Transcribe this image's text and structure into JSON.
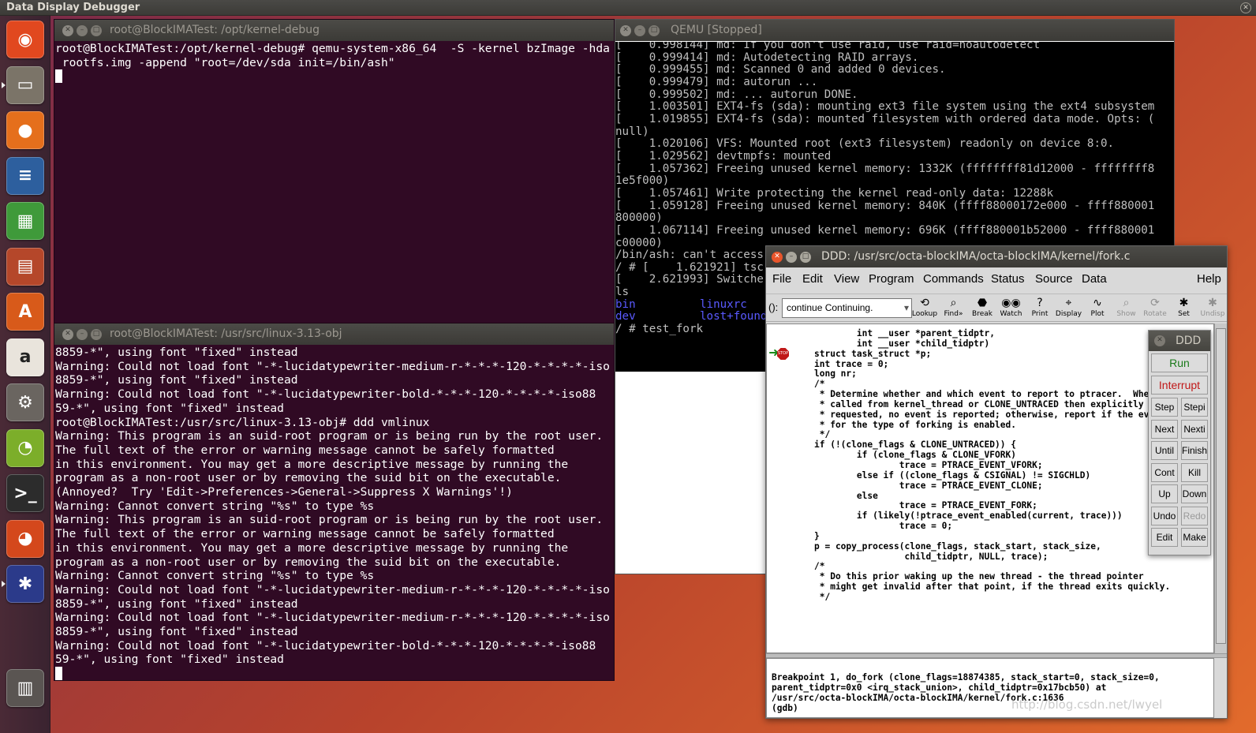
{
  "topbar": {
    "title": "Data Display Debugger"
  },
  "launcher": {
    "items": [
      {
        "name": "ubuntu-dash-icon",
        "glyph": "◉",
        "bg": "#e1481f"
      },
      {
        "name": "files-icon",
        "glyph": "▭",
        "bg": "#7b7468"
      },
      {
        "name": "firefox-icon",
        "glyph": "●",
        "bg": "#e56f1c"
      },
      {
        "name": "writer-icon",
        "glyph": "≡",
        "bg": "#2d5f9e"
      },
      {
        "name": "calc-icon",
        "glyph": "▦",
        "bg": "#3f9a3a"
      },
      {
        "name": "impress-icon",
        "glyph": "▤",
        "bg": "#b5472a"
      },
      {
        "name": "software-center-icon",
        "glyph": "A",
        "bg": "#d85a1a"
      },
      {
        "name": "amazon-icon",
        "glyph": "a",
        "bg": "#e9e4dc"
      },
      {
        "name": "system-settings-icon",
        "glyph": "⚙",
        "bg": "#6a6560"
      },
      {
        "name": "ide-icon",
        "glyph": "◔",
        "bg": "#7cae2a"
      },
      {
        "name": "terminal-icon",
        "glyph": ">_",
        "bg": "#2c2c2c"
      },
      {
        "name": "parrot-icon",
        "glyph": "◕",
        "bg": "#d4481c"
      },
      {
        "name": "ddd-bug-icon",
        "glyph": "✱",
        "bg": "#2b3a8a"
      },
      {
        "name": "trash-icon",
        "glyph": "▥",
        "bg": "#5a5552"
      }
    ]
  },
  "term1": {
    "title": "root@BlockIMATest: /opt/kernel-debug",
    "lines": [
      "root@BlockIMATest:/opt/kernel-debug# qemu-system-x86_64  -S -kernel bzImage -hda",
      " rootfs.img -append \"root=/dev/sda init=/bin/ash\""
    ]
  },
  "term2": {
    "title": "root@BlockIMATest: /usr/src/linux-3.13-obj",
    "lines": [
      "8859-*\", using font \"fixed\" instead",
      "Warning: Could not load font \"-*-lucidatypewriter-medium-r-*-*-*-120-*-*-*-*-iso",
      "8859-*\", using font \"fixed\" instead",
      "Warning: Could not load font \"-*-lucidatypewriter-bold-*-*-*-120-*-*-*-*-iso88",
      "59-*\", using font \"fixed\" instead",
      "root@BlockIMATest:/usr/src/linux-3.13-obj# ddd vmlinux",
      "Warning: This program is an suid-root program or is being run by the root user.",
      "The full text of the error or warning message cannot be safely formatted",
      "in this environment. You may get a more descriptive message by running the",
      "program as a non-root user or by removing the suid bit on the executable.",
      "(Annoyed?  Try 'Edit->Preferences->General->Suppress X Warnings'!)",
      "Warning: Cannot convert string \"%s\" to type %s",
      "Warning: This program is an suid-root program or is being run by the root user.",
      "The full text of the error or warning message cannot be safely formatted",
      "in this environment. You may get a more descriptive message by running the",
      "program as a non-root user or by removing the suid bit on the executable.",
      "Warning: Cannot convert string \"%s\" to type %s",
      "Warning: Could not load font \"-*-lucidatypewriter-medium-r-*-*-*-120-*-*-*-*-iso",
      "8859-*\", using font \"fixed\" instead",
      "Warning: Could not load font \"-*-lucidatypewriter-medium-r-*-*-*-120-*-*-*-*-iso",
      "8859-*\", using font \"fixed\" instead",
      "Warning: Could not load font \"-*-lucidatypewriter-bold-*-*-*-120-*-*-*-*-iso88",
      "59-*\", using font \"fixed\" instead"
    ]
  },
  "qemu": {
    "title": "QEMU [Stopped]",
    "lines": [
      "[    0.998144] md: If you don't use raid, use raid=noautodetect",
      "[    0.999414] md: Autodetecting RAID arrays.",
      "[    0.999455] md: Scanned 0 and added 0 devices.",
      "[    0.999479] md: autorun ...",
      "[    0.999502] md: ... autorun DONE.",
      "[    1.003501] EXT4-fs (sda): mounting ext3 file system using the ext4 subsystem",
      "[    1.019855] EXT4-fs (sda): mounted filesystem with ordered data mode. Opts: (",
      "null)",
      "[    1.020106] VFS: Mounted root (ext3 filesystem) readonly on device 8:0.",
      "[    1.029562] devtmpfs: mounted",
      "[    1.057362] Freeing unused kernel memory: 1332K (ffffffff81d12000 - ffffffff8",
      "1e5f000)",
      "[    1.057461] Write protecting the kernel read-only data: 12288k",
      "[    1.059128] Freeing unused kernel memory: 840K (ffff88000172e000 - ffff880001",
      "800000)",
      "[    1.067114] Freeing unused kernel memory: 696K (ffff880001b52000 - ffff880001",
      "c00000)",
      "/bin/ash: can't access",
      "/ # [    1.621921] tsc",
      "[    2.621993] Switche",
      "ls"
    ],
    "ls_col1": [
      "bin",
      "dev"
    ],
    "ls_col2": [
      "linuxrc",
      "lost+found"
    ],
    "prompt": "/ # test_fork"
  },
  "ddd": {
    "title": "DDD: /usr/src/octa-blockIMA/octa-blockIMA/kernel/fork.c",
    "menus": [
      "File",
      "Edit",
      "View",
      "Program",
      "Commands",
      "Status",
      "Source",
      "Data"
    ],
    "help": "Help",
    "arg_label": "():",
    "arg_value": "continue Continuing.",
    "tools": [
      {
        "label": "Lookup",
        "icon": "⟲",
        "disabled": false
      },
      {
        "label": "Find»",
        "icon": "⌕",
        "disabled": false
      },
      {
        "label": "Break",
        "icon": "⬣",
        "disabled": false
      },
      {
        "label": "Watch",
        "icon": "◉◉",
        "disabled": false
      },
      {
        "label": "Print",
        "icon": "?",
        "disabled": false
      },
      {
        "label": "Display",
        "icon": "⌖",
        "disabled": false
      },
      {
        "label": "Plot",
        "icon": "∿",
        "disabled": false
      },
      {
        "label": "Show",
        "icon": "⌕",
        "disabled": true
      },
      {
        "label": "Rotate",
        "icon": "⟳",
        "disabled": true
      },
      {
        "label": "Set",
        "icon": "✱",
        "disabled": false
      },
      {
        "label": "Undisp",
        "icon": "✱",
        "disabled": true
      }
    ],
    "stop_label": "STOP",
    "source": [
      "        int __user *parent_tidptr,",
      "        int __user *child_tidptr)",
      "",
      "struct task_struct *p;",
      "int trace = 0;",
      "long nr;",
      "",
      "/*",
      " * Determine whether and which event to report to ptracer.  When",
      " * called from kernel_thread or CLONE_UNTRACED then explicitly",
      " * requested, no event is reported; otherwise, report if the event",
      " * for the type of forking is enabled.",
      " */",
      "if (!(clone_flags & CLONE_UNTRACED)) {",
      "        if (clone_flags & CLONE_VFORK)",
      "                trace = PTRACE_EVENT_VFORK;",
      "        else if ((clone_flags & CSIGNAL) != SIGCHLD)",
      "                trace = PTRACE_EVENT_CLONE;",
      "        else",
      "                trace = PTRACE_EVENT_FORK;",
      "",
      "        if (likely(!ptrace_event_enabled(current, trace)))",
      "                trace = 0;",
      "}",
      "",
      "p = copy_process(clone_flags, stack_start, stack_size,",
      "                 child_tidptr, NULL, trace);",
      "/*",
      " * Do this prior waking up the new thread - the thread pointer",
      " * might get invalid after that point, if the thread exits quickly.",
      " */"
    ],
    "gdb": [
      "Breakpoint 1, do_fork (clone_flags=18874385, stack_start=0, stack_size=0,",
      "parent_tidptr=0x0 <irq_stack_union>, child_tidptr=0x17bcb50) at",
      "/usr/src/octa-blockIMA/octa-blockIMA/kernel/fork.c:1636",
      "(gdb) "
    ]
  },
  "cmdtool": {
    "title": "DDD",
    "run": "Run",
    "interrupt": "Interrupt",
    "pairs": [
      [
        "Step",
        "Stepi"
      ],
      [
        "Next",
        "Nexti"
      ],
      [
        "Until",
        "Finish"
      ],
      [
        "Cont",
        "Kill"
      ],
      [
        "Up",
        "Down"
      ],
      [
        "Undo",
        "Redo"
      ],
      [
        "Edit",
        "Make"
      ]
    ],
    "disabled": [
      "Redo"
    ]
  },
  "watermark": "http://blog.csdn.net/lwyel"
}
